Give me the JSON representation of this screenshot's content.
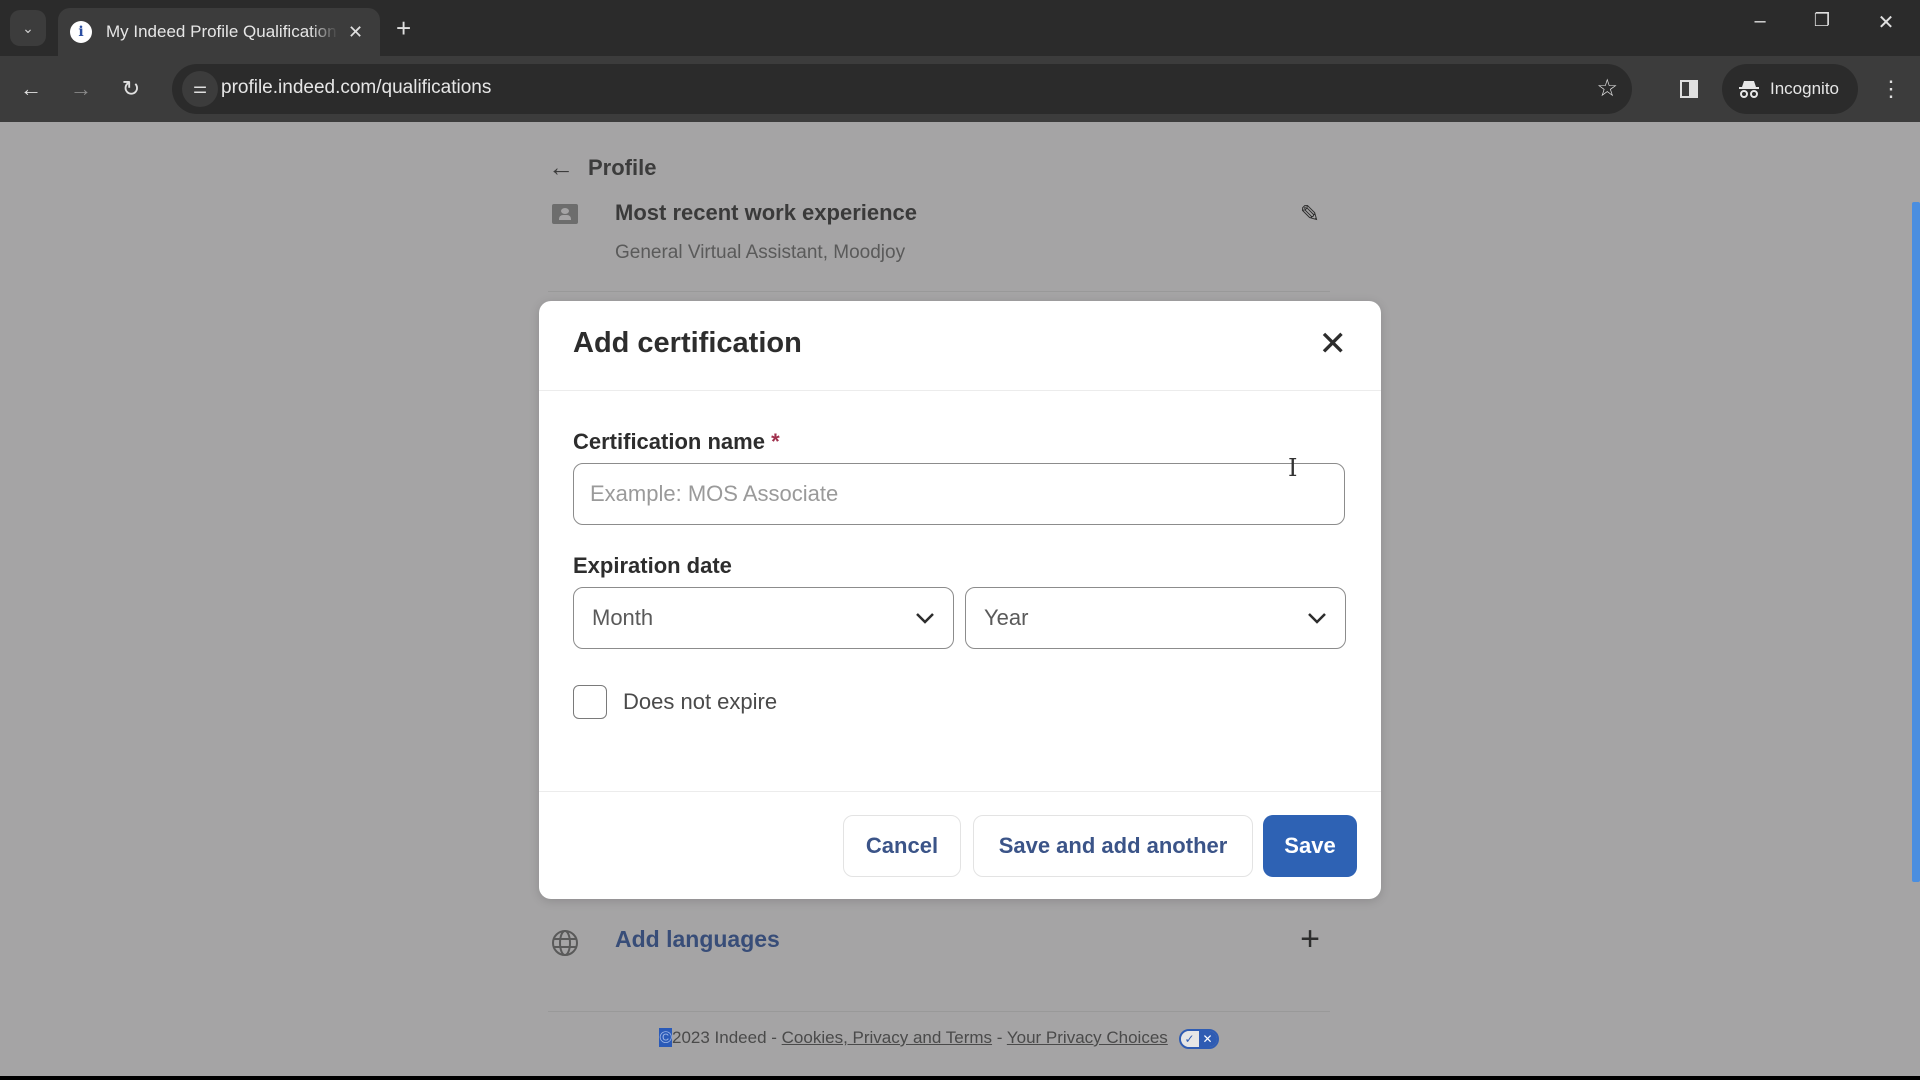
{
  "browser": {
    "tab_title": "My Indeed Profile Qualifications",
    "tab_favicon": "i",
    "url": "profile.indeed.com/qualifications",
    "incognito_label": "Incognito",
    "window_controls": {
      "minimize": "–",
      "restore": "❐",
      "close": "✕"
    }
  },
  "page": {
    "back_link": "Profile",
    "work_experience": {
      "title": "Most recent work experience",
      "subtitle": "General Virtual Assistant, Moodjoy"
    },
    "languages": {
      "label": "Add languages"
    },
    "footer": {
      "copyright_symbol": "©",
      "copyright_text": "2023 Indeed - ",
      "link_terms": "Cookies, Privacy and Terms",
      "separator": " - ",
      "link_privacy": "Your Privacy Choices",
      "badge_ok": "✓",
      "badge_no": "✕"
    }
  },
  "modal": {
    "title": "Add certification",
    "cert_name_label": "Certification name",
    "required_marker": "*",
    "cert_name_placeholder": "Example: MOS Associate",
    "cert_name_value": "",
    "expiration_label": "Expiration date",
    "month_select": "Month",
    "year_select": "Year",
    "does_not_expire_label": "Does not expire",
    "does_not_expire_checked": false,
    "buttons": {
      "cancel": "Cancel",
      "save_and_add": "Save and add another",
      "save": "Save"
    }
  },
  "colors": {
    "primary": "#2e62b4",
    "link_text": "#3b5488",
    "required": "#a0314d",
    "scrollbar": "#4a8ee0"
  }
}
